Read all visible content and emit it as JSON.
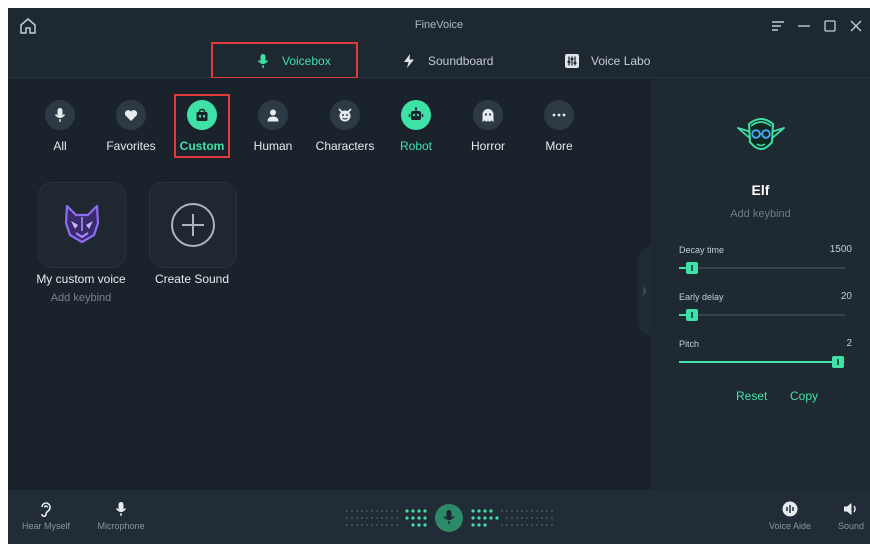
{
  "window": {
    "title": "FineVoice"
  },
  "tabs": [
    {
      "label": "Voicebox",
      "icon": "microphone-icon",
      "active": true
    },
    {
      "label": "Soundboard",
      "icon": "lightning-icon",
      "active": false
    },
    {
      "label": "Voice Labo",
      "icon": "equalizer-icon",
      "active": false
    }
  ],
  "categories": [
    {
      "label": "All",
      "icon": "microphone-icon"
    },
    {
      "label": "Favorites",
      "icon": "heart-icon"
    },
    {
      "label": "Custom",
      "icon": "custom-bag-icon",
      "active": true
    },
    {
      "label": "Human",
      "icon": "person-icon"
    },
    {
      "label": "Characters",
      "icon": "devil-face-icon"
    },
    {
      "label": "Robot",
      "icon": "robot-icon",
      "highlighted": true
    },
    {
      "label": "Horror",
      "icon": "ghost-icon"
    },
    {
      "label": "More",
      "icon": "more-dots-icon"
    }
  ],
  "cards": [
    {
      "name": "My custom voice",
      "sub": "Add keybind",
      "icon": "fox-mask-icon"
    },
    {
      "name": "Create Sound",
      "icon": "plus-circle-icon"
    }
  ],
  "panel": {
    "voice_name": "Elf",
    "keybind": "Add keybind",
    "sliders": [
      {
        "label": "Decay time",
        "value": "1500",
        "fraction": 0.08
      },
      {
        "label": "Early delay",
        "value": "20",
        "fraction": 0.08
      },
      {
        "label": "Pitch",
        "value": "2",
        "fraction": 0.96
      }
    ],
    "reset_label": "Reset",
    "copy_label": "Copy"
  },
  "bottom": {
    "hear_myself": "Hear Myself",
    "microphone": "Microphone",
    "voice_aide": "Voice Aide",
    "sound": "Sound"
  },
  "colors": {
    "accent": "#3fe2a6",
    "background": "#1a232c",
    "panel": "#1f2932",
    "highlight_box": "#e23a3a"
  }
}
